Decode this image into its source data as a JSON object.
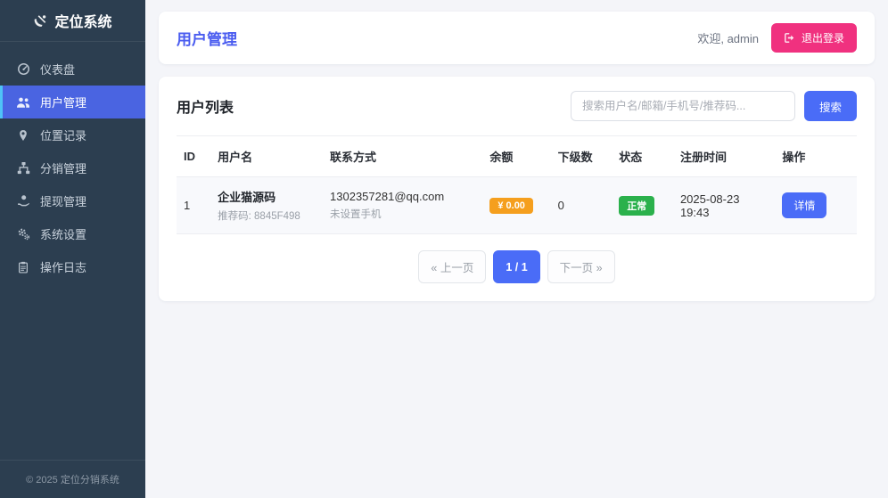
{
  "colors": {
    "sidebar_bg": "#2c3e50",
    "accent_blue": "#4a6cf7",
    "active_blue": "#4a64e1",
    "active_border": "#4fc3f7",
    "pink": "#f0317f",
    "orange": "#f59f1e",
    "green": "#2bb14c",
    "page_bg": "#f4f5f9"
  },
  "sidebar": {
    "logo": "定位系统",
    "logo_icon": "satellite-dish-icon",
    "items": [
      {
        "label": "仪表盘",
        "icon": "gauge-icon"
      },
      {
        "label": "用户管理",
        "icon": "users-icon"
      },
      {
        "label": "位置记录",
        "icon": "map-marker-icon"
      },
      {
        "label": "分销管理",
        "icon": "sitemap-icon"
      },
      {
        "label": "提现管理",
        "icon": "withdraw-icon"
      },
      {
        "label": "系统设置",
        "icon": "gears-icon"
      },
      {
        "label": "操作日志",
        "icon": "clipboard-icon"
      }
    ],
    "footer": "© 2025 定位分销系统"
  },
  "header": {
    "title": "用户管理",
    "welcome": "欢迎, admin",
    "logout": "退出登录"
  },
  "panel": {
    "title": "用户列表",
    "search_placeholder": "搜索用户名/邮箱/手机号/推荐码...",
    "search_button": "搜索"
  },
  "table": {
    "headers": [
      "ID",
      "用户名",
      "联系方式",
      "余额",
      "下级数",
      "状态",
      "注册时间",
      "操作"
    ],
    "rows": [
      {
        "id": "1",
        "username": "企业猫源码",
        "ref_code": "推荐码: 8845F498",
        "email": "1302357281@qq.com",
        "phone": "未设置手机",
        "balance": "¥ 0.00",
        "subordinates": "0",
        "status": "正常",
        "registered": "2025-08-23 19:43",
        "action": "详情"
      }
    ]
  },
  "pagination": {
    "prev": "« 上一页",
    "current": "1 / 1",
    "next": "下一页 »"
  }
}
